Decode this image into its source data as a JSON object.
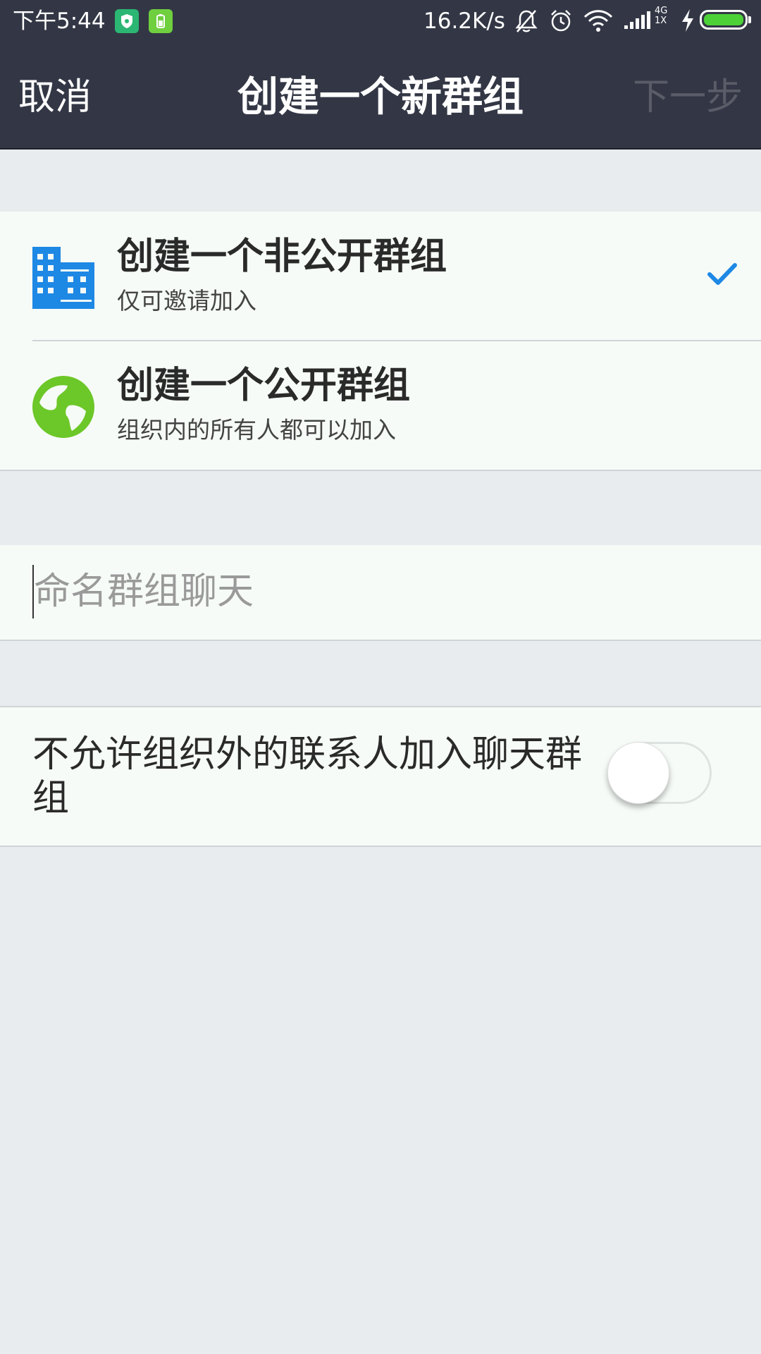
{
  "status_bar": {
    "time": "下午5:44",
    "net_speed": "16.2K/s",
    "network_top": "4G",
    "network_bottom": "1X",
    "battery_level": 1.0,
    "icons": [
      "shield-app-icon",
      "battery-app-icon",
      "bell-muted-icon",
      "alarm-icon",
      "wifi-icon",
      "signal-icon",
      "charging-icon",
      "battery-icon"
    ]
  },
  "nav": {
    "cancel_label": "取消",
    "title": "创建一个新群组",
    "next_label": "下一步"
  },
  "options": [
    {
      "title": "创建一个非公开群组",
      "subtitle": "仅可邀请加入",
      "icon": "building-icon",
      "icon_color": "#1e88e5",
      "selected": true
    },
    {
      "title": "创建一个公开群组",
      "subtitle": "组织内的所有人都可以加入",
      "icon": "globe-icon",
      "icon_color": "#6cc728",
      "selected": false
    }
  ],
  "name_field": {
    "placeholder": "命名群组聊天",
    "value": ""
  },
  "external_toggle": {
    "label": "不允许组织外的联系人加入聊天群组",
    "on": false
  },
  "colors": {
    "header_bg": "#333745",
    "check": "#1e88e5",
    "page_bg": "#e8ecef",
    "card_bg": "#f6fbf7"
  }
}
